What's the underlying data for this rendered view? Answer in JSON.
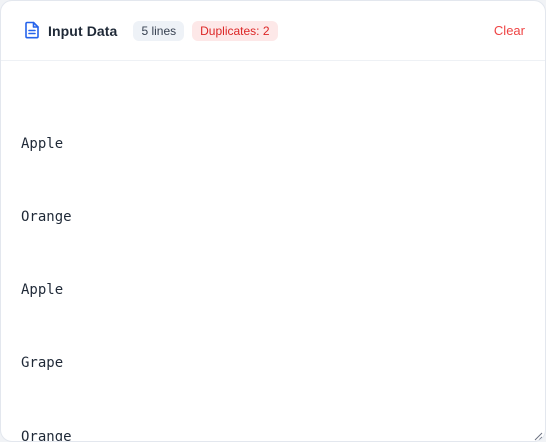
{
  "header": {
    "icon": "file-text-icon",
    "title": "Input Data",
    "lines_badge": "5 lines",
    "duplicates_badge": "Duplicates: 2",
    "clear_label": "Clear"
  },
  "editor": {
    "lines": [
      "Apple",
      "Orange",
      "Apple",
      "Grape",
      "Orange"
    ]
  },
  "colors": {
    "accent": "#2563eb",
    "danger": "#ef4444",
    "badge_neutral_bg": "#eef2f7",
    "badge_danger_bg": "#fde8e8"
  }
}
